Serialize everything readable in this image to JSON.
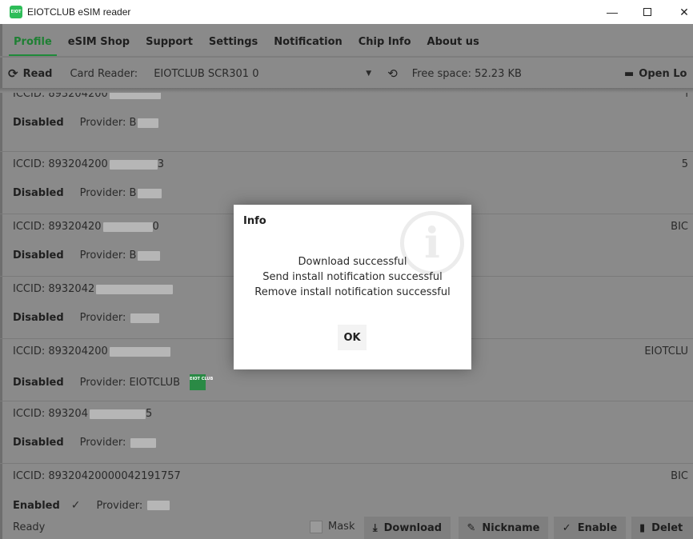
{
  "window": {
    "title": "EIOTCLUB eSIM reader",
    "icon_text": "EIOT",
    "minimize": "—",
    "close": "✕"
  },
  "tabs": [
    {
      "label": "Profile",
      "active": true
    },
    {
      "label": "eSIM Shop"
    },
    {
      "label": "Support"
    },
    {
      "label": "Settings"
    },
    {
      "label": "Notification"
    },
    {
      "label": "Chip Info"
    },
    {
      "label": "About us"
    }
  ],
  "toolbar": {
    "read_label": "Read",
    "card_reader_label": "Card Reader:",
    "card_reader_value": "EIOTCLUB SCR301 0",
    "free_space": "Free space: 52.23 KB",
    "open_log_label": "Open Lo"
  },
  "profiles": [
    {
      "iccid": "ICCID: 893204200",
      "nickname": "l",
      "state": "Disabled",
      "provider": "Provider: B"
    },
    {
      "iccid": "ICCID: 893204200",
      "iccid_tail": "3",
      "nickname": "5",
      "state": "Disabled",
      "provider": "Provider: B"
    },
    {
      "iccid": "ICCID: 89320420",
      "iccid_tail": "0",
      "nickname": "BIC",
      "state": "Disabled",
      "provider": "Provider: B"
    },
    {
      "iccid": "ICCID: 8932042",
      "nickname": "",
      "state": "Disabled",
      "provider": "Provider: "
    },
    {
      "iccid": "ICCID: 893204200",
      "nickname": "EIOTCLU",
      "state": "Disabled",
      "provider": "Provider: EIOTCLUB",
      "logo_text": "EIOT CLUB"
    },
    {
      "iccid": "ICCID: 893204",
      "iccid_tail": "5",
      "nickname": "",
      "state": "Disabled",
      "provider": "Provider: "
    },
    {
      "iccid": "ICCID: 89320420000042191757",
      "nickname": "BIC",
      "state": "Enabled",
      "check": "✓",
      "provider": "Provider: "
    }
  ],
  "statusbar": {
    "status": "Ready",
    "mask_label": "Mask",
    "download_label": "Download",
    "nickname_label": "Nickname",
    "enable_label": "Enable",
    "delete_label": "Delet"
  },
  "dialog": {
    "title": "Info",
    "icon_glyph": "i",
    "lines": [
      "Download successful",
      "Send install notification successful",
      "Remove install notification successful"
    ],
    "ok_label": "OK"
  },
  "colors": {
    "accent": "#1f8b3a",
    "dim_overlay": "#8a8a8a",
    "dialog_bg": "#ffffff"
  }
}
